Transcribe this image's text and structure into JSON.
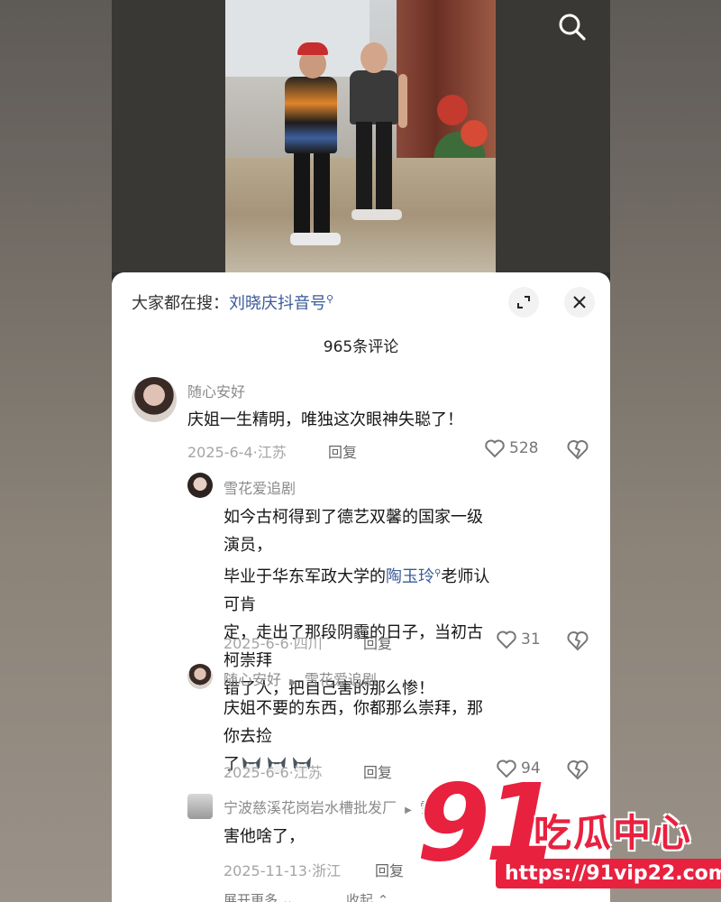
{
  "video": {
    "search_icon": "search-icon"
  },
  "comments_panel": {
    "hot_search_prefix": "大家都在搜：",
    "hot_search_keyword": "刘晓庆抖音号",
    "comment_count": "965条评论",
    "expand_icon": "expand-icon",
    "close_icon": "close-icon"
  },
  "comments": [
    {
      "username": "随心安好",
      "text": "庆姐一生精明，唯独这次眼神失聪了！",
      "date_location": "2025-6-4·江苏",
      "reply_label": "回复",
      "likes": "528"
    }
  ],
  "replies": [
    {
      "username": "雪花爱追剧",
      "text_line1": "如今古柯得到了德艺双馨的国家一级演员，",
      "text_line2_pre": "毕业于华东军政大学的",
      "text_line2_mention": "陶玉玲",
      "text_line2_post": "老师认可肯",
      "text_line3": "定，走出了那段阴霾的日子，当初古柯崇拜",
      "text_line4": "错了人，把自己害的那么惨！",
      "date_location": "2025-6-6·四川",
      "reply_label": "回复",
      "likes": "31"
    },
    {
      "username": "随心安好",
      "reply_to_arrow": "▶",
      "reply_to": "雪花爱追剧",
      "text_line1": "庆姐不要的东西，你都那么崇拜，那你去捡",
      "text_line2": "了",
      "date_location": "2025-6-6·江苏",
      "reply_label": "回复",
      "likes": "94"
    },
    {
      "username": "宁波慈溪花岗岩水槽批发厂",
      "reply_to_arrow": "▶",
      "reply_to": "雪",
      "text": "害他啥了，",
      "date_location": "2025-11-13·浙江",
      "reply_label": "回复"
    }
  ],
  "footer": {
    "expand_more": "展开更多",
    "collapse": "收起"
  },
  "watermark": {
    "logo_number": "91",
    "title": "吃瓜中心",
    "url": "https://91vip22.com"
  },
  "colors": {
    "mention": "#3b5a99",
    "watermark_red": "#e8213f"
  }
}
